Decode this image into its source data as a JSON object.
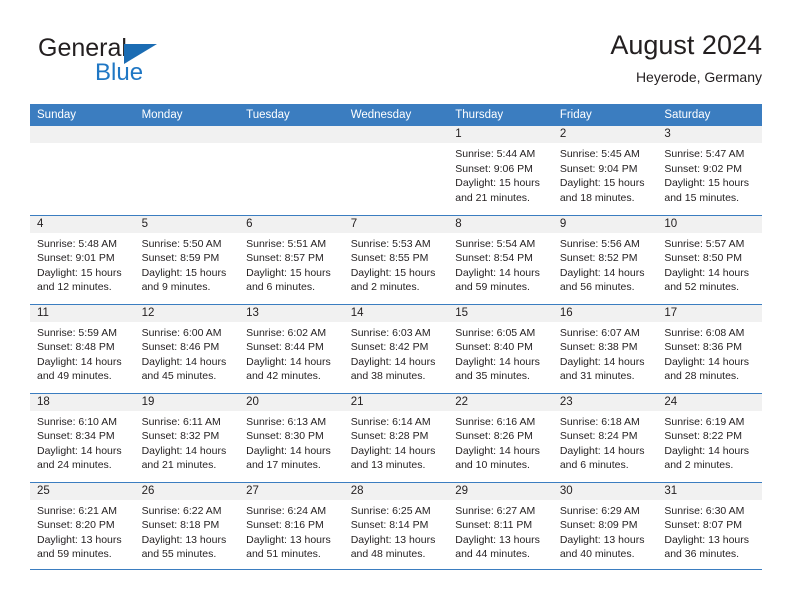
{
  "brand": {
    "name_part1": "General",
    "name_part2": "Blue",
    "flag_icon": "triangle-flag-icon"
  },
  "header": {
    "title": "August 2024",
    "subtitle": "Heyerode, Germany"
  },
  "colors": {
    "header_blue": "#3b7dc0",
    "brand_blue": "#1f77c4",
    "daynum_band": "#f1f1f1",
    "text": "#231f20"
  },
  "weekday_headers": [
    "Sunday",
    "Monday",
    "Tuesday",
    "Wednesday",
    "Thursday",
    "Friday",
    "Saturday"
  ],
  "weeks": [
    [
      {
        "day": "",
        "empty": true,
        "line1": "",
        "line2": "",
        "line3": "",
        "line4": ""
      },
      {
        "day": "",
        "empty": true,
        "line1": "",
        "line2": "",
        "line3": "",
        "line4": ""
      },
      {
        "day": "",
        "empty": true,
        "line1": "",
        "line2": "",
        "line3": "",
        "line4": ""
      },
      {
        "day": "",
        "empty": true,
        "line1": "",
        "line2": "",
        "line3": "",
        "line4": ""
      },
      {
        "day": "1",
        "empty": false,
        "line1": "Sunrise: 5:44 AM",
        "line2": "Sunset: 9:06 PM",
        "line3": "Daylight: 15 hours",
        "line4": "and 21 minutes."
      },
      {
        "day": "2",
        "empty": false,
        "line1": "Sunrise: 5:45 AM",
        "line2": "Sunset: 9:04 PM",
        "line3": "Daylight: 15 hours",
        "line4": "and 18 minutes."
      },
      {
        "day": "3",
        "empty": false,
        "line1": "Sunrise: 5:47 AM",
        "line2": "Sunset: 9:02 PM",
        "line3": "Daylight: 15 hours",
        "line4": "and 15 minutes."
      }
    ],
    [
      {
        "day": "4",
        "empty": false,
        "line1": "Sunrise: 5:48 AM",
        "line2": "Sunset: 9:01 PM",
        "line3": "Daylight: 15 hours",
        "line4": "and 12 minutes."
      },
      {
        "day": "5",
        "empty": false,
        "line1": "Sunrise: 5:50 AM",
        "line2": "Sunset: 8:59 PM",
        "line3": "Daylight: 15 hours",
        "line4": "and 9 minutes."
      },
      {
        "day": "6",
        "empty": false,
        "line1": "Sunrise: 5:51 AM",
        "line2": "Sunset: 8:57 PM",
        "line3": "Daylight: 15 hours",
        "line4": "and 6 minutes."
      },
      {
        "day": "7",
        "empty": false,
        "line1": "Sunrise: 5:53 AM",
        "line2": "Sunset: 8:55 PM",
        "line3": "Daylight: 15 hours",
        "line4": "and 2 minutes."
      },
      {
        "day": "8",
        "empty": false,
        "line1": "Sunrise: 5:54 AM",
        "line2": "Sunset: 8:54 PM",
        "line3": "Daylight: 14 hours",
        "line4": "and 59 minutes."
      },
      {
        "day": "9",
        "empty": false,
        "line1": "Sunrise: 5:56 AM",
        "line2": "Sunset: 8:52 PM",
        "line3": "Daylight: 14 hours",
        "line4": "and 56 minutes."
      },
      {
        "day": "10",
        "empty": false,
        "line1": "Sunrise: 5:57 AM",
        "line2": "Sunset: 8:50 PM",
        "line3": "Daylight: 14 hours",
        "line4": "and 52 minutes."
      }
    ],
    [
      {
        "day": "11",
        "empty": false,
        "line1": "Sunrise: 5:59 AM",
        "line2": "Sunset: 8:48 PM",
        "line3": "Daylight: 14 hours",
        "line4": "and 49 minutes."
      },
      {
        "day": "12",
        "empty": false,
        "line1": "Sunrise: 6:00 AM",
        "line2": "Sunset: 8:46 PM",
        "line3": "Daylight: 14 hours",
        "line4": "and 45 minutes."
      },
      {
        "day": "13",
        "empty": false,
        "line1": "Sunrise: 6:02 AM",
        "line2": "Sunset: 8:44 PM",
        "line3": "Daylight: 14 hours",
        "line4": "and 42 minutes."
      },
      {
        "day": "14",
        "empty": false,
        "line1": "Sunrise: 6:03 AM",
        "line2": "Sunset: 8:42 PM",
        "line3": "Daylight: 14 hours",
        "line4": "and 38 minutes."
      },
      {
        "day": "15",
        "empty": false,
        "line1": "Sunrise: 6:05 AM",
        "line2": "Sunset: 8:40 PM",
        "line3": "Daylight: 14 hours",
        "line4": "and 35 minutes."
      },
      {
        "day": "16",
        "empty": false,
        "line1": "Sunrise: 6:07 AM",
        "line2": "Sunset: 8:38 PM",
        "line3": "Daylight: 14 hours",
        "line4": "and 31 minutes."
      },
      {
        "day": "17",
        "empty": false,
        "line1": "Sunrise: 6:08 AM",
        "line2": "Sunset: 8:36 PM",
        "line3": "Daylight: 14 hours",
        "line4": "and 28 minutes."
      }
    ],
    [
      {
        "day": "18",
        "empty": false,
        "line1": "Sunrise: 6:10 AM",
        "line2": "Sunset: 8:34 PM",
        "line3": "Daylight: 14 hours",
        "line4": "and 24 minutes."
      },
      {
        "day": "19",
        "empty": false,
        "line1": "Sunrise: 6:11 AM",
        "line2": "Sunset: 8:32 PM",
        "line3": "Daylight: 14 hours",
        "line4": "and 21 minutes."
      },
      {
        "day": "20",
        "empty": false,
        "line1": "Sunrise: 6:13 AM",
        "line2": "Sunset: 8:30 PM",
        "line3": "Daylight: 14 hours",
        "line4": "and 17 minutes."
      },
      {
        "day": "21",
        "empty": false,
        "line1": "Sunrise: 6:14 AM",
        "line2": "Sunset: 8:28 PM",
        "line3": "Daylight: 14 hours",
        "line4": "and 13 minutes."
      },
      {
        "day": "22",
        "empty": false,
        "line1": "Sunrise: 6:16 AM",
        "line2": "Sunset: 8:26 PM",
        "line3": "Daylight: 14 hours",
        "line4": "and 10 minutes."
      },
      {
        "day": "23",
        "empty": false,
        "line1": "Sunrise: 6:18 AM",
        "line2": "Sunset: 8:24 PM",
        "line3": "Daylight: 14 hours",
        "line4": "and 6 minutes."
      },
      {
        "day": "24",
        "empty": false,
        "line1": "Sunrise: 6:19 AM",
        "line2": "Sunset: 8:22 PM",
        "line3": "Daylight: 14 hours",
        "line4": "and 2 minutes."
      }
    ],
    [
      {
        "day": "25",
        "empty": false,
        "line1": "Sunrise: 6:21 AM",
        "line2": "Sunset: 8:20 PM",
        "line3": "Daylight: 13 hours",
        "line4": "and 59 minutes."
      },
      {
        "day": "26",
        "empty": false,
        "line1": "Sunrise: 6:22 AM",
        "line2": "Sunset: 8:18 PM",
        "line3": "Daylight: 13 hours",
        "line4": "and 55 minutes."
      },
      {
        "day": "27",
        "empty": false,
        "line1": "Sunrise: 6:24 AM",
        "line2": "Sunset: 8:16 PM",
        "line3": "Daylight: 13 hours",
        "line4": "and 51 minutes."
      },
      {
        "day": "28",
        "empty": false,
        "line1": "Sunrise: 6:25 AM",
        "line2": "Sunset: 8:14 PM",
        "line3": "Daylight: 13 hours",
        "line4": "and 48 minutes."
      },
      {
        "day": "29",
        "empty": false,
        "line1": "Sunrise: 6:27 AM",
        "line2": "Sunset: 8:11 PM",
        "line3": "Daylight: 13 hours",
        "line4": "and 44 minutes."
      },
      {
        "day": "30",
        "empty": false,
        "line1": "Sunrise: 6:29 AM",
        "line2": "Sunset: 8:09 PM",
        "line3": "Daylight: 13 hours",
        "line4": "and 40 minutes."
      },
      {
        "day": "31",
        "empty": false,
        "line1": "Sunrise: 6:30 AM",
        "line2": "Sunset: 8:07 PM",
        "line3": "Daylight: 13 hours",
        "line4": "and 36 minutes."
      }
    ]
  ]
}
